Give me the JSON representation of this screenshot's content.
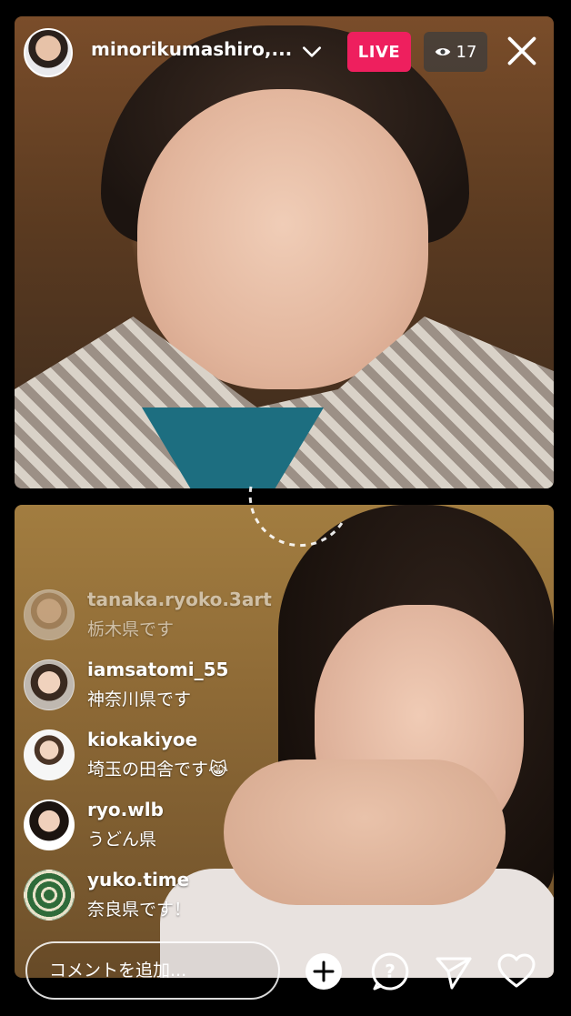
{
  "header": {
    "username": "minorikumashiro,...",
    "live_label": "LIVE",
    "viewer_count": "17"
  },
  "comments": [
    {
      "user": "tanaka.ryoko.3art",
      "text": "栃木県です",
      "faded": true
    },
    {
      "user": "iamsatomi_55",
      "text": "神奈川県です"
    },
    {
      "user": "kiokakiyoe",
      "text": "埼玉の田舎です😹"
    },
    {
      "user": "ryo.wlb",
      "text": "うどん県"
    },
    {
      "user": "yuko.time",
      "text": "奈良県です！"
    }
  ],
  "composer": {
    "placeholder": "コメントを追加..."
  },
  "icons": [
    "chevron-down-icon",
    "eye-icon",
    "close-icon",
    "add-icon",
    "question-icon",
    "send-icon",
    "heart-icon"
  ],
  "colors": {
    "live_badge": "#ee1f5e"
  }
}
